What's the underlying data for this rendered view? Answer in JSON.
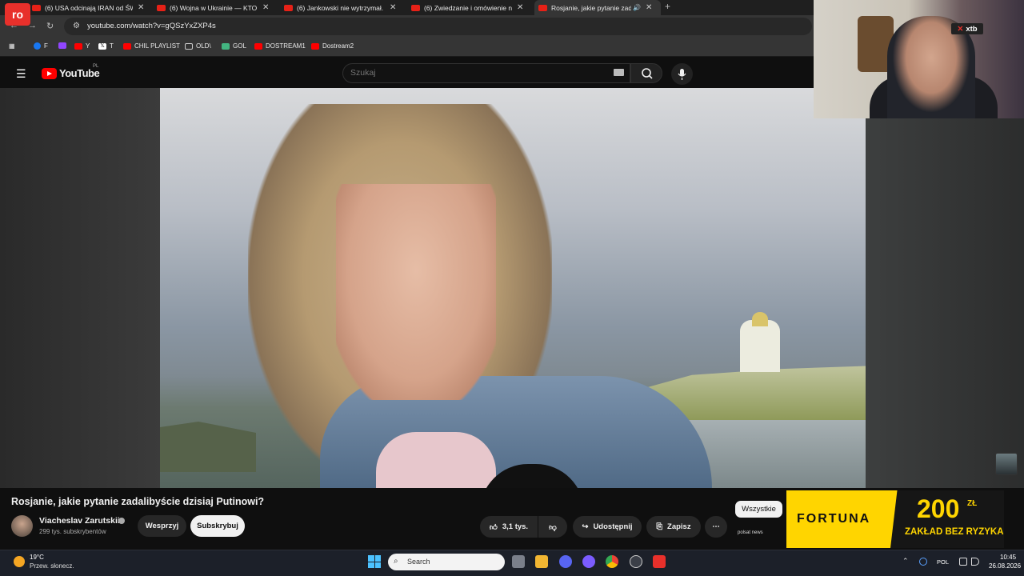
{
  "browser": {
    "tabs": [
      {
        "title": "(6) USA odcinają IRAN od ŚWIA"
      },
      {
        "title": "(6) Wojna w Ukrainie — KTO NA"
      },
      {
        "title": "(6) Jankowski nie wytrzymał. \"Z"
      },
      {
        "title": "(6) Zwiedzanie i omówienie na"
      },
      {
        "title": "Rosjanie, jakie pytanie zada"
      }
    ],
    "new_tab": "+",
    "url": "youtube.com/watch?v=gQSzYxZXP4s",
    "bookmarks": [
      {
        "label": "F",
        "color": "#1877f2"
      },
      {
        "label": "",
        "color": "#9146ff"
      },
      {
        "label": "Y",
        "color": "#ff0000"
      },
      {
        "label": "T",
        "color": "#000000"
      },
      {
        "label": "CHIL PLAYLIST",
        "color": "#ff0000"
      },
      {
        "label": "OLD\\",
        "color": "#888888"
      },
      {
        "label": "GOL",
        "color": "#43b581"
      },
      {
        "label": "DOSTREAM1",
        "color": "#ff0000"
      },
      {
        "label": "Dostream2",
        "color": "#ff0000"
      }
    ]
  },
  "overlay": {
    "logo_text": "ro",
    "sponsor_badge": "xtb"
  },
  "youtube": {
    "logo_text": "YouTube",
    "region": "PL",
    "search_placeholder": "Szukaj",
    "video": {
      "title": "Rosjanie, jakie pytanie zadalibyście dzisiaj Putinowi?",
      "channel_name": "Viacheslav Zarutskii",
      "subscribers": "299 tys. subskrybentów",
      "support_label": "Wesprzyj",
      "subscribe_label": "Subskrybuj",
      "likes": "3,1 tys.",
      "share_label": "Udostępnij",
      "save_label": "Zapisz"
    },
    "chip_all": "Wszystkie"
  },
  "ad": {
    "brand": "FORTUNA",
    "amount": "200",
    "currency": "ZŁ",
    "tagline": "ZAKŁAD BEZ RYZYKA",
    "partner": "polsat news"
  },
  "taskbar": {
    "weather_temp": "19°C",
    "weather_desc": "Przew. słonecz.",
    "search_label": "Search",
    "language": "POL",
    "time": "10:45",
    "date": "26.08.2026"
  },
  "colors": {
    "yt_red": "#ff0000",
    "fortuna_yellow": "#ffd500",
    "background": "#0f0f0f"
  }
}
